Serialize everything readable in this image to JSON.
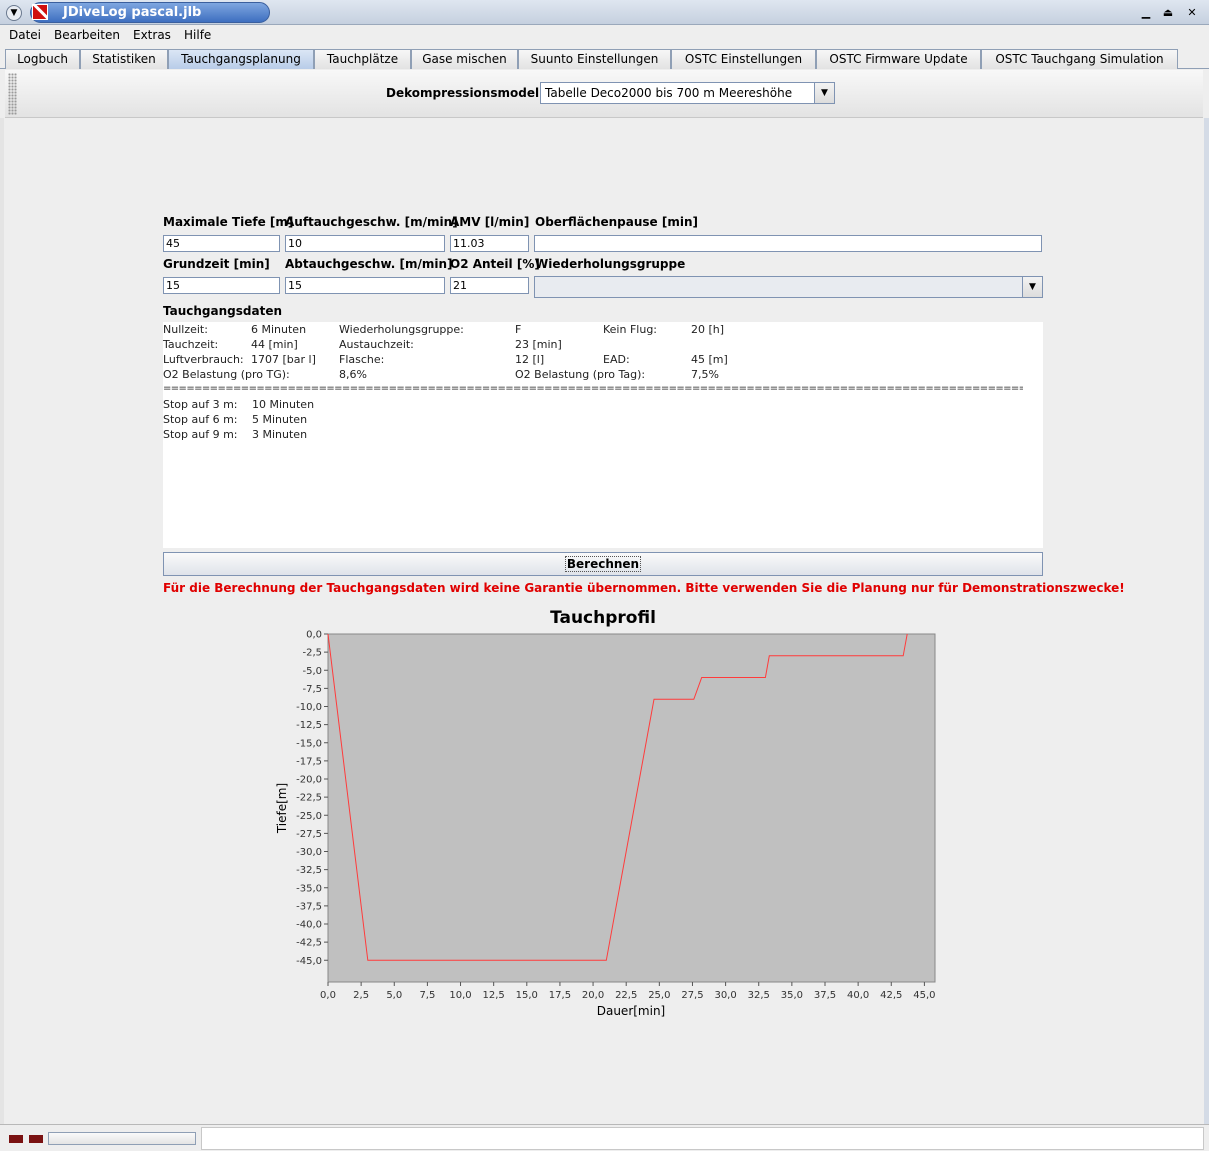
{
  "window": {
    "title": "JDiveLog pascal.jlb"
  },
  "menu": [
    "Datei",
    "Bearbeiten",
    "Extras",
    "Hilfe"
  ],
  "tabs": [
    {
      "label": "Logbuch",
      "active": false
    },
    {
      "label": "Statistiken",
      "active": false
    },
    {
      "label": "Tauchgangsplanung",
      "active": true
    },
    {
      "label": "Tauchplätze",
      "active": false
    },
    {
      "label": "Gase mischen",
      "active": false
    },
    {
      "label": "Suunto Einstellungen",
      "active": false
    },
    {
      "label": "OSTC Einstellungen",
      "active": false
    },
    {
      "label": "OSTC Firmware Update",
      "active": false
    },
    {
      "label": "OSTC Tauchgang Simulation",
      "active": false
    }
  ],
  "toolbar": {
    "model_label": "Dekompressionsmodel",
    "model_value": "Tabelle Deco2000 bis 700 m Meereshöhe"
  },
  "form": {
    "max_depth_label": "Maximale Tiefe [m]",
    "max_depth": "45",
    "ascent_label": "Auftauchgeschw. [m/min]",
    "ascent": "10",
    "amv_label": "AMV [l/min]",
    "amv": "11.03",
    "surface_label": "Oberflächenpause [min]",
    "surface": "",
    "bottom_label": "Grundzeit [min]",
    "bottom": "15",
    "descent_label": "Abtauchgeschw. [m/min]",
    "descent": "15",
    "o2_label": "O2 Anteil [%]",
    "o2": "21",
    "group_label": "Wiederholungsgruppe",
    "group": ""
  },
  "results": {
    "title": "Tauchgangsdaten",
    "nullzeit_label": "Nullzeit:",
    "nullzeit": "6 Minuten",
    "wg_label": "Wiederholungsgruppe:",
    "wg": "F",
    "flug_label": "Kein Flug:",
    "flug": "20 [h]",
    "tauchzeit_label": "Tauchzeit:",
    "tauchzeit": "44 [min]",
    "austauch_label": "Austauchzeit:",
    "austauch": "23 [min]",
    "luft_label": "Luftverbrauch:",
    "luft": "1707 [bar l]",
    "flasche_label": "Flasche:",
    "flasche": "12 [l]",
    "ead_label": "EAD:",
    "ead": "45 [m]",
    "o2tg_label": "O2 Belastung (pro TG):",
    "o2tg": "8,6%",
    "o2tag_label": "O2 Belastung (pro Tag):",
    "o2tag": "7,5%",
    "separator": "==============================================================================================================================",
    "stops": [
      {
        "label": "Stop auf 3 m:",
        "value": "10 Minuten"
      },
      {
        "label": "Stop auf 6 m:",
        "value": "5 Minuten"
      },
      {
        "label": "Stop auf 9 m:",
        "value": "3 Minuten"
      }
    ]
  },
  "button": {
    "calculate": "Berechnen"
  },
  "warning": "Für die Berechnung der Tauchgangsdaten wird keine Garantie übernommen. Bitte verwenden Sie die Planung nur für Demonstrationszwecke!",
  "chart_data": {
    "type": "line",
    "title": "Tauchprofil",
    "xlabel": "Dauer[min]",
    "ylabel": "Tiefe[m]",
    "xlim": [
      0,
      45.8
    ],
    "ylim": [
      -48,
      0
    ],
    "xticks": [
      "0,0",
      "2,5",
      "5,0",
      "7,5",
      "10,0",
      "12,5",
      "15,0",
      "17,5",
      "20,0",
      "22,5",
      "25,0",
      "27,5",
      "30,0",
      "32,5",
      "35,0",
      "37,5",
      "40,0",
      "42,5",
      "45,0"
    ],
    "yticks": [
      "0,0",
      "-2,5",
      "-5,0",
      "-7,5",
      "-10,0",
      "-12,5",
      "-15,0",
      "-17,5",
      "-20,0",
      "-22,5",
      "-25,0",
      "-27,5",
      "-30,0",
      "-32,5",
      "-35,0",
      "-37,5",
      "-40,0",
      "-42,5",
      "-45,0"
    ],
    "grid": false,
    "line_color": "#ff3b3b",
    "plot_bg": "#c0c0c0",
    "series": [
      {
        "x": [
          0,
          3,
          21,
          24.6,
          27.6,
          28.2,
          33.0,
          33.3,
          43.4,
          43.7
        ],
        "y": [
          0,
          -45,
          -45,
          -9,
          -9,
          -6,
          -6,
          -3,
          -3,
          0
        ]
      }
    ]
  }
}
